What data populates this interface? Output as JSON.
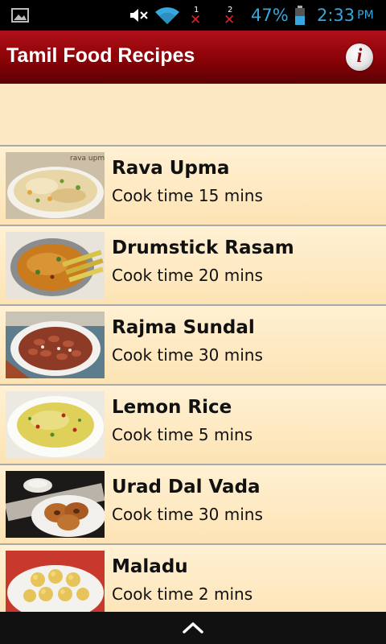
{
  "status_bar": {
    "battery_percent": "47%",
    "time": "2:33",
    "ampm": "PM",
    "sim1_label": "1",
    "sim2_label": "2",
    "accent_color": "#36a8df"
  },
  "header": {
    "title": "Tamil Food Recipes",
    "info_label": "i",
    "background_color": "#8a0308"
  },
  "recipes": [
    {
      "name": "Rava Upma",
      "time": "Cook time 15 mins",
      "image_caption": "rava upma",
      "icon": "rava-upma-photo"
    },
    {
      "name": "Drumstick Rasam",
      "time": "Cook time 20 mins",
      "icon": "drumstick-rasam-photo"
    },
    {
      "name": "Rajma Sundal",
      "time": "Cook time 30 mins",
      "icon": "rajma-sundal-photo"
    },
    {
      "name": "Lemon Rice",
      "time": "Cook time 5 mins",
      "icon": "lemon-rice-photo"
    },
    {
      "name": "Urad Dal Vada",
      "time": "Cook time 30 mins",
      "icon": "urad-dal-vada-photo"
    },
    {
      "name": "Maladu",
      "time": "Cook time 2 mins",
      "icon": "maladu-photo"
    }
  ],
  "bottom_bar": {
    "icon": "chevron-up-icon"
  }
}
